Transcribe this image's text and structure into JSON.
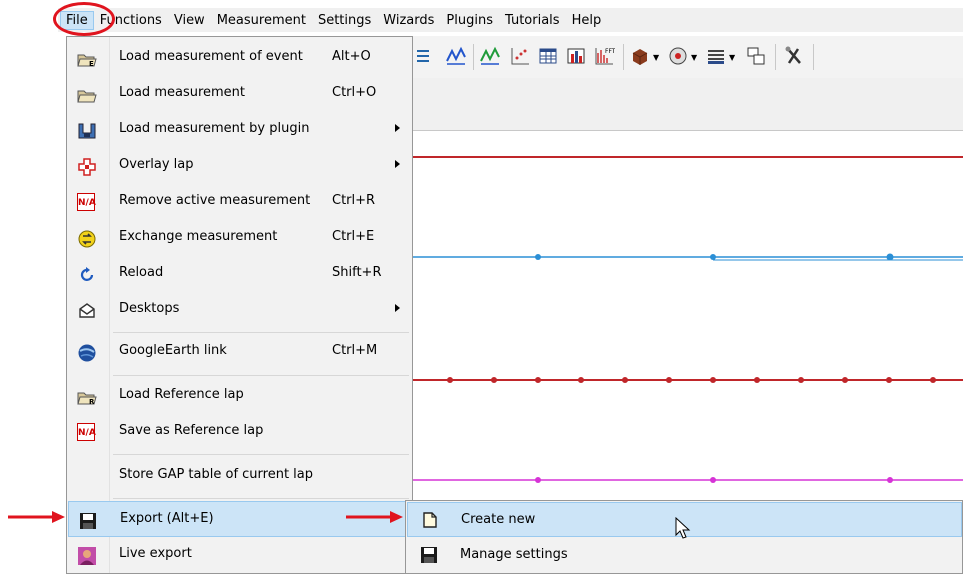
{
  "menubar": {
    "items": [
      "File",
      "Functions",
      "View",
      "Measurement",
      "Settings",
      "Wizards",
      "Plugins",
      "Tutorials",
      "Help"
    ]
  },
  "file_menu": {
    "items": [
      {
        "label": "Load measurement of event",
        "shortcut": "Alt+O",
        "icon": "folder-event-icon"
      },
      {
        "label": "Load measurement",
        "shortcut": "Ctrl+O",
        "icon": "folder-open-icon"
      },
      {
        "label": "Load measurement by plugin",
        "shortcut": "",
        "icon": "plugin-icon",
        "submenu": true
      },
      {
        "label": "Overlay lap",
        "shortcut": "",
        "icon": "overlay-icon",
        "submenu": true
      },
      {
        "label": "Remove active measurement",
        "shortcut": "Ctrl+R",
        "icon": "na-icon",
        "icon_text": "N/A"
      },
      {
        "label": "Exchange measurement",
        "shortcut": "Ctrl+E",
        "icon": "exchange-icon"
      },
      {
        "label": "Reload",
        "shortcut": "Shift+R",
        "icon": "reload-icon"
      },
      {
        "label": "Desktops",
        "shortcut": "",
        "icon": "desktops-icon",
        "submenu": true
      },
      {
        "label": "GoogleEarth link",
        "shortcut": "Ctrl+M",
        "icon": "globe-icon"
      },
      {
        "label": "Load Reference lap",
        "shortcut": "",
        "icon": "folder-reference-icon"
      },
      {
        "label": "Save as Reference lap",
        "shortcut": "",
        "icon": "na-icon",
        "icon_text": "N/A"
      },
      {
        "label": "Store GAP table of current lap",
        "shortcut": "",
        "icon": ""
      },
      {
        "label": "Export (Alt+E)",
        "shortcut": "",
        "icon": "floppy-disk-icon",
        "highlighted": true
      },
      {
        "label": "Live export",
        "shortcut": "",
        "icon": "live-export-icon"
      }
    ]
  },
  "export_submenu": {
    "items": [
      {
        "label": "Create new",
        "icon": "new-document-icon",
        "highlighted": true
      },
      {
        "label": "Manage settings",
        "icon": "floppy-disk-icon"
      }
    ]
  },
  "colors": {
    "highlight": "#cce4f7",
    "highlight_border": "#99c9ef",
    "annotation_red": "#e0141e",
    "trace_red": "#c0262a",
    "trace_blue": "#2b8fd6",
    "trace_magenta": "#d633d6"
  }
}
